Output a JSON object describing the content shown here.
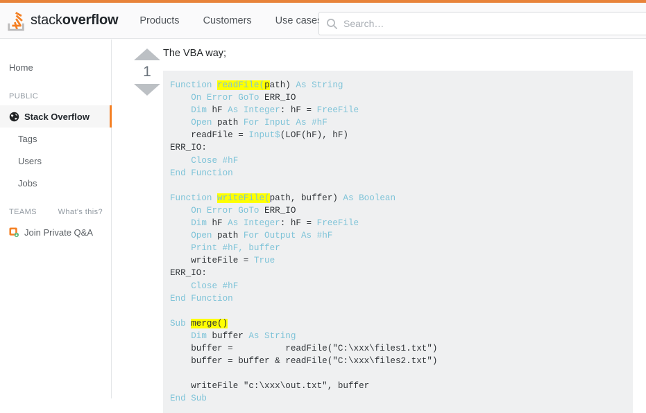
{
  "theme": {
    "accent": "#f48024",
    "topbar": "#e8833a",
    "code_bg": "#eff0f1",
    "keyword_color": "#7ec3d8",
    "highlight_color": "#ffff00",
    "active_border": "#f48024"
  },
  "header": {
    "logo_text_light": "stack",
    "logo_text_bold": "overflow",
    "logo_icon": "stack-overflow-logo-icon",
    "nav": [
      {
        "label": "Products",
        "name": "nav-products"
      },
      {
        "label": "Customers",
        "name": "nav-customers"
      },
      {
        "label": "Use cases",
        "name": "nav-use-cases"
      }
    ],
    "search": {
      "placeholder": "Search…",
      "value": "",
      "icon": "search-icon"
    }
  },
  "sidebar": {
    "home": {
      "label": "Home",
      "icon": "home-item"
    },
    "public_header": "PUBLIC",
    "public_items": [
      {
        "label": "Stack Overflow",
        "icon": "globe-icon",
        "active": true
      },
      {
        "label": "Tags",
        "active": false
      },
      {
        "label": "Users",
        "active": false
      },
      {
        "label": "Jobs",
        "active": false
      }
    ],
    "teams_header": "TEAMS",
    "whats_this": "What's this?",
    "teams_item": {
      "label": "Join Private Q&A",
      "icon": "teams-badge-icon"
    }
  },
  "post": {
    "vote": {
      "up_icon": "vote-up-arrow-icon",
      "down_icon": "vote-down-arrow-icon",
      "score": "1"
    },
    "intro_text": "The VBA way;",
    "code_language": "vba",
    "code_lines": [
      [
        {
          "t": "Function ",
          "c": "kw"
        },
        {
          "t": "readFile(",
          "c": "hl kw"
        },
        {
          "t": "p",
          "c": "hl pl"
        },
        {
          "t": "ath) ",
          "c": "pl"
        },
        {
          "t": "As String",
          "c": "kw"
        }
      ],
      [
        {
          "t": "    ",
          "c": "pl"
        },
        {
          "t": "On Error GoTo ",
          "c": "kw"
        },
        {
          "t": "ERR_IO",
          "c": "pl"
        }
      ],
      [
        {
          "t": "    ",
          "c": "pl"
        },
        {
          "t": "Dim ",
          "c": "kw"
        },
        {
          "t": "hF ",
          "c": "pl"
        },
        {
          "t": "As Integer",
          "c": "kw"
        },
        {
          "t": ": hF = ",
          "c": "pl"
        },
        {
          "t": "FreeFile",
          "c": "kw"
        }
      ],
      [
        {
          "t": "    ",
          "c": "pl"
        },
        {
          "t": "Open ",
          "c": "kw"
        },
        {
          "t": "path ",
          "c": "pl"
        },
        {
          "t": "For Input As ",
          "c": "kw"
        },
        {
          "t": "#hF",
          "c": "kw"
        }
      ],
      [
        {
          "t": "    readFile = ",
          "c": "pl"
        },
        {
          "t": "Input$",
          "c": "kw"
        },
        {
          "t": "(LOF(hF), hF)",
          "c": "pl"
        }
      ],
      [
        {
          "t": "ERR_IO:",
          "c": "pl"
        }
      ],
      [
        {
          "t": "    ",
          "c": "pl"
        },
        {
          "t": "Close #hF",
          "c": "kw"
        }
      ],
      [
        {
          "t": "End Function",
          "c": "kw"
        }
      ],
      [
        {
          "t": "",
          "c": "pl"
        }
      ],
      [
        {
          "t": "Function ",
          "c": "kw"
        },
        {
          "t": "writeFile(",
          "c": "hl kw"
        },
        {
          "t": "path, buffer) ",
          "c": "pl"
        },
        {
          "t": "As Boolean",
          "c": "kw"
        }
      ],
      [
        {
          "t": "    ",
          "c": "pl"
        },
        {
          "t": "On Error GoTo ",
          "c": "kw"
        },
        {
          "t": "ERR_IO",
          "c": "pl"
        }
      ],
      [
        {
          "t": "    ",
          "c": "pl"
        },
        {
          "t": "Dim ",
          "c": "kw"
        },
        {
          "t": "hF ",
          "c": "pl"
        },
        {
          "t": "As Integer",
          "c": "kw"
        },
        {
          "t": ": hF = ",
          "c": "pl"
        },
        {
          "t": "FreeFile",
          "c": "kw"
        }
      ],
      [
        {
          "t": "    ",
          "c": "pl"
        },
        {
          "t": "Open ",
          "c": "kw"
        },
        {
          "t": "path ",
          "c": "pl"
        },
        {
          "t": "For Output As ",
          "c": "kw"
        },
        {
          "t": "#hF",
          "c": "kw"
        }
      ],
      [
        {
          "t": "    ",
          "c": "pl"
        },
        {
          "t": "Print #hF, buffer",
          "c": "kw"
        }
      ],
      [
        {
          "t": "    writeFile = ",
          "c": "pl"
        },
        {
          "t": "True",
          "c": "kw"
        }
      ],
      [
        {
          "t": "ERR_IO:",
          "c": "pl"
        }
      ],
      [
        {
          "t": "    ",
          "c": "pl"
        },
        {
          "t": "Close #hF",
          "c": "kw"
        }
      ],
      [
        {
          "t": "End Function",
          "c": "kw"
        }
      ],
      [
        {
          "t": "",
          "c": "pl"
        }
      ],
      [
        {
          "t": "Sub ",
          "c": "kw"
        },
        {
          "t": "merge()",
          "c": "hl pl"
        }
      ],
      [
        {
          "t": "    ",
          "c": "pl"
        },
        {
          "t": "Dim ",
          "c": "kw"
        },
        {
          "t": "buffer ",
          "c": "pl"
        },
        {
          "t": "As String",
          "c": "kw"
        }
      ],
      [
        {
          "t": "    buffer =          readFile(\"C:\\xxx\\files1.txt\")",
          "c": "pl"
        }
      ],
      [
        {
          "t": "    buffer = buffer & readFile(\"C:\\xxx\\files2.txt\")",
          "c": "pl"
        }
      ],
      [
        {
          "t": "",
          "c": "pl"
        }
      ],
      [
        {
          "t": "    writeFile ",
          "c": "pl"
        },
        {
          "t": "\"c:\\xxx\\out.txt\", buffer",
          "c": "pl"
        }
      ],
      [
        {
          "t": "End Sub",
          "c": "kw"
        }
      ]
    ]
  }
}
